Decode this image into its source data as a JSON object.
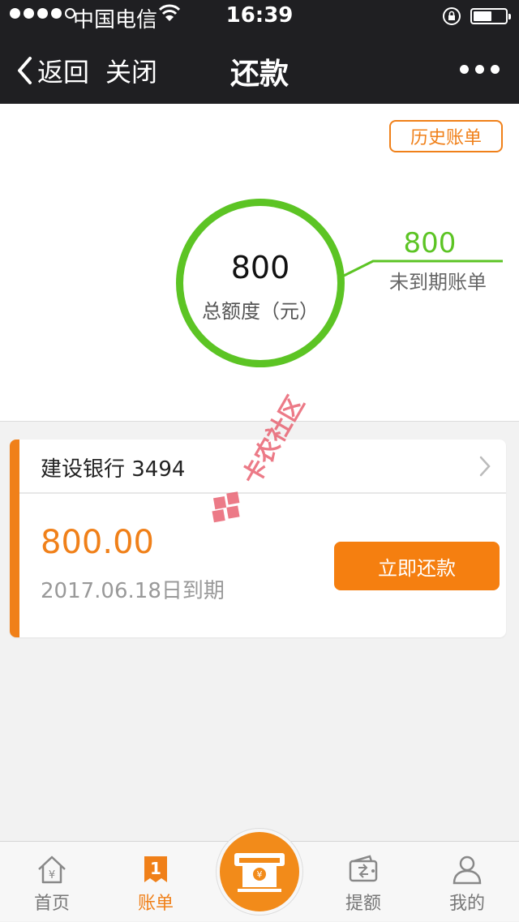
{
  "status_bar": {
    "carrier": "中国电信",
    "time": "16:39"
  },
  "nav": {
    "back_label": "返回",
    "close_label": "关闭",
    "title": "还款"
  },
  "summary": {
    "history_label": "历史账单",
    "total_amount": "800",
    "total_label": "总额度（元）",
    "due_amount": "800",
    "due_label": "未到期账单"
  },
  "bill": {
    "bank": "建设银行 3494",
    "amount": "800.00",
    "due_date": "2017.06.18日到期",
    "pay_label": "立即还款"
  },
  "tabs": [
    {
      "label": "首页",
      "icon": "home-icon"
    },
    {
      "label": "账单",
      "icon": "bill-icon"
    },
    {
      "label": "提额",
      "icon": "wallet-icon"
    },
    {
      "label": "我的",
      "icon": "user-icon"
    }
  ],
  "watermark": "卡农社区",
  "colors": {
    "accent": "#f08019",
    "green": "#5cc424",
    "nav_bg": "#1f1f22"
  }
}
